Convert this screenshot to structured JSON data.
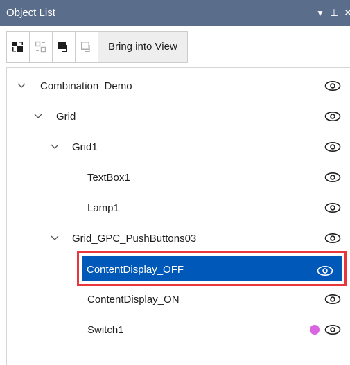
{
  "panel": {
    "title": "Object List",
    "title_buttons": [
      "chevron-down-icon",
      "pin-icon",
      "close-icon"
    ]
  },
  "toolbar": {
    "icons": [
      "group-objects-icon",
      "ungroup-objects-icon",
      "bring-to-front-icon",
      "send-to-back-icon"
    ],
    "bring_into_view_label": "Bring into View"
  },
  "tree": {
    "items": [
      {
        "label": "Combination_Demo",
        "level": 0,
        "expandable": true,
        "expanded": true
      },
      {
        "label": "Grid",
        "level": 1,
        "expandable": true,
        "expanded": true
      },
      {
        "label": "Grid1",
        "level": 2,
        "expandable": true,
        "expanded": true
      },
      {
        "label": "TextBox1",
        "level": 3,
        "expandable": false
      },
      {
        "label": "Lamp1",
        "level": 3,
        "expandable": false
      },
      {
        "label": "Grid_GPC_PushButtons03",
        "level": 2,
        "expandable": true,
        "expanded": true
      },
      {
        "label": "ContentDisplay_OFF",
        "level": 3,
        "expandable": false,
        "selected": true
      },
      {
        "label": "ContentDisplay_ON",
        "level": 3,
        "expandable": false
      },
      {
        "label": "Switch1",
        "level": 3,
        "expandable": false,
        "status_dot": true
      }
    ]
  },
  "colors": {
    "title_bar": "#5a6d8b",
    "selection": "#0059b8",
    "highlight_border": "#e8383d",
    "status_dot": "#d966e0"
  }
}
